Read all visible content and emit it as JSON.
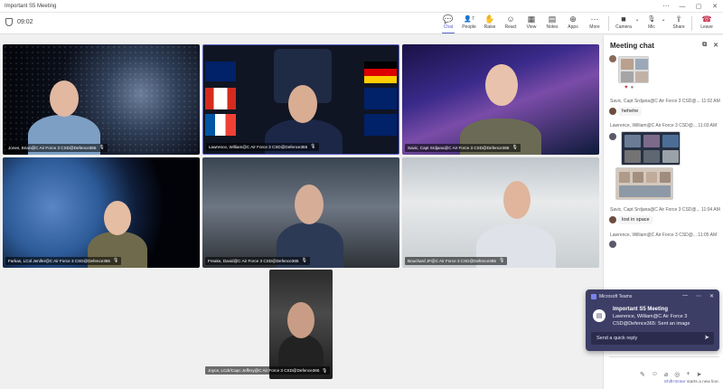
{
  "window": {
    "title": "Important S5 Meeting"
  },
  "toolbar": {
    "timer": "09:02",
    "buttons": [
      {
        "label": "Chat",
        "icon": "chat-icon",
        "glyph": "💬"
      },
      {
        "label": "People",
        "icon": "people-icon",
        "glyph": "👥",
        "count": "7"
      },
      {
        "label": "Raise",
        "icon": "hand-icon",
        "glyph": "✋"
      },
      {
        "label": "React",
        "icon": "smile-icon",
        "glyph": "☺"
      },
      {
        "label": "View",
        "icon": "grid-icon",
        "glyph": "▦"
      },
      {
        "label": "Notes",
        "icon": "notes-icon",
        "glyph": "▤"
      },
      {
        "label": "Apps",
        "icon": "apps-icon",
        "glyph": "⊕"
      },
      {
        "label": "More",
        "icon": "more-icon",
        "glyph": "⋯"
      },
      {
        "label": "Camera",
        "icon": "camera-icon",
        "glyph": "■"
      },
      {
        "label": "Mic",
        "icon": "mic-off-icon",
        "glyph": "🎙"
      },
      {
        "label": "Share",
        "icon": "share-icon",
        "glyph": "⇪"
      },
      {
        "label": "Leave",
        "icon": "phone-hangup-icon",
        "glyph": "☎"
      }
    ]
  },
  "participants": [
    {
      "name": "Jones, Brian@C Air Force 3 CSD@Defence365"
    },
    {
      "name": "Lawrence, William@C Air Force 3 CSD@Defence365"
    },
    {
      "name": "Savic, Capt Srdjana@C Air Force 3 CSD@Defence365"
    },
    {
      "name": "Farkas, LCol Jenifer@C Air Force 3 CSD@Defence365"
    },
    {
      "name": "Freake, David@C Air Force 3 CSD@Defence365"
    },
    {
      "name": "Bouchard JF@C Air Force 3 CSD@Defence365"
    },
    {
      "name": "Joyce, LCdr/Capc Jeffery@C Air Force 3 CSD@Defence365"
    }
  ],
  "chat": {
    "title": "Meeting chat",
    "messages": [
      {
        "sender": "Savic, Capt Srdjana@C Air Force 3 CSD@...",
        "time": "11:02 AM",
        "text": "hehehe"
      },
      {
        "sender": "Lawrence, William@C Air Force 3 CSD@...",
        "time": "11:03 AM",
        "text": ""
      },
      {
        "sender": "Savic, Capt Srdjana@C Air Force 3 CSD@...",
        "time": "11:04 AM",
        "text": "lost in space"
      },
      {
        "sender": "Lawrence, William@C Air Force 3 CSD@...",
        "time": "11:05 AM",
        "text": ""
      }
    ],
    "hint_key": "Shift+Enter",
    "hint_text": " starts a new line."
  },
  "toast": {
    "app": "Microsoft Teams",
    "title": "Important S5 Meeting",
    "body": "Lawrence, William@C Air Force 3 CSD@Defence365: Sent an image",
    "reply_placeholder": "Send a quick reply"
  },
  "colors": {
    "accent": "#5b5fc7",
    "leave": "#c4314b",
    "toast_bg": "#3d3e66"
  }
}
